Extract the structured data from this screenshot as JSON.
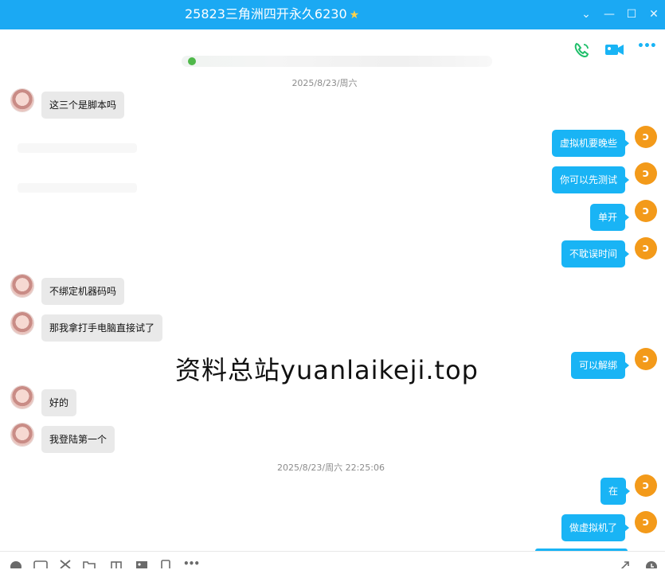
{
  "window": {
    "title": "25823三角洲四开永久6230",
    "title_star": "★",
    "btn_dropdown": "⌄",
    "btn_min": "—",
    "btn_max": "☐",
    "btn_close": "✕"
  },
  "toolbar": {
    "more": "•••"
  },
  "timestamps": {
    "first": "2025/8/23/周六",
    "second": "2025/8/23/周六 22:25:06"
  },
  "messages": [
    {
      "side": "in",
      "text": "这三个是脚本吗"
    },
    {
      "side": "out",
      "text": "虚拟机要晚些"
    },
    {
      "side": "out",
      "text": "你可以先测试"
    },
    {
      "side": "out",
      "text": "单开"
    },
    {
      "side": "out",
      "text": "不耽误时间"
    },
    {
      "side": "in",
      "text": "不绑定机器码吗"
    },
    {
      "side": "in",
      "text": "那我拿打手电脑直接试了"
    },
    {
      "side": "out",
      "text": "可以解绑"
    },
    {
      "side": "in",
      "text": "好的"
    },
    {
      "side": "in",
      "text": "我登陆第一个"
    },
    {
      "side": "out",
      "text": "在"
    },
    {
      "side": "out",
      "text": "做虚拟机了"
    }
  ],
  "my_avatar_glyph": "ↄ",
  "watermark": "资料总站yuanlaikeji.top",
  "colors": {
    "titlebar": "#1ba9f3",
    "outgoing_bubble": "#19b4f5",
    "incoming_bubble": "#e9e9e9",
    "phone_icon": "#1fbf6a",
    "video_icon": "#19b4f5",
    "my_avatar": "#f39a1a"
  }
}
